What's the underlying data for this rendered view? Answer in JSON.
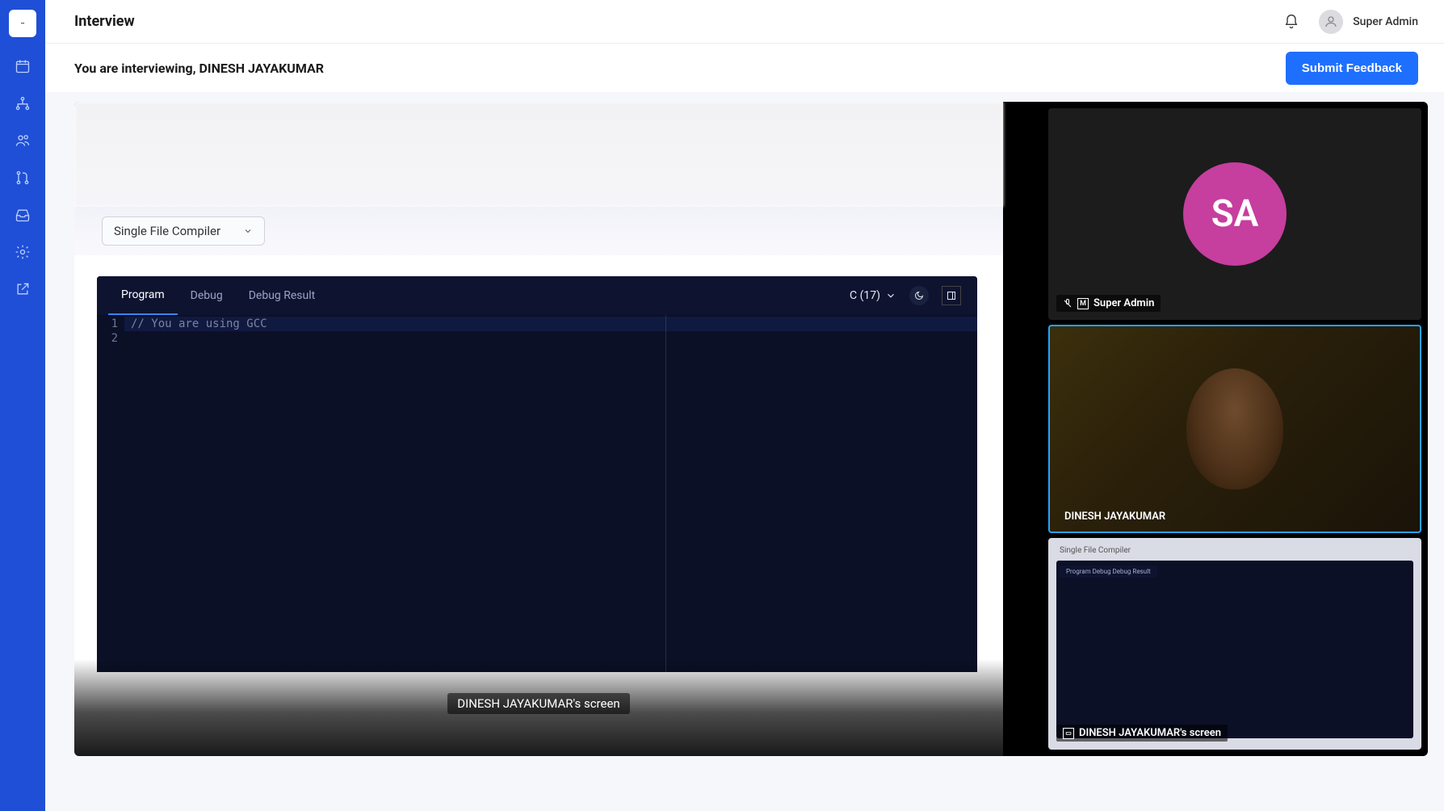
{
  "header": {
    "title": "Interview",
    "user_name": "Super Admin"
  },
  "sub_header": {
    "title": "You are interviewing, DINESH JAYAKUMAR",
    "submit_label": "Submit Feedback"
  },
  "compiler": {
    "dropdown_label": "Single File Compiler"
  },
  "editor": {
    "tabs": {
      "program": "Program",
      "debug": "Debug",
      "debug_result": "Debug Result"
    },
    "language_label": "C (17)",
    "line_numbers": [
      "1",
      "2"
    ],
    "code_line_1": "// You are using GCC"
  },
  "shared_screen": {
    "footer_label": "DINESH JAYAKUMAR's screen"
  },
  "video": {
    "tile1": {
      "initials": "SA",
      "name": "Super Admin",
      "m_indicator": "M"
    },
    "tile2": {
      "name": "DINESH JAYAKUMAR"
    },
    "tile3": {
      "top_label": "Single File Compiler",
      "mini_tabs": "Program   Debug   Debug Result",
      "name": "DINESH JAYAKUMAR's screen"
    }
  }
}
